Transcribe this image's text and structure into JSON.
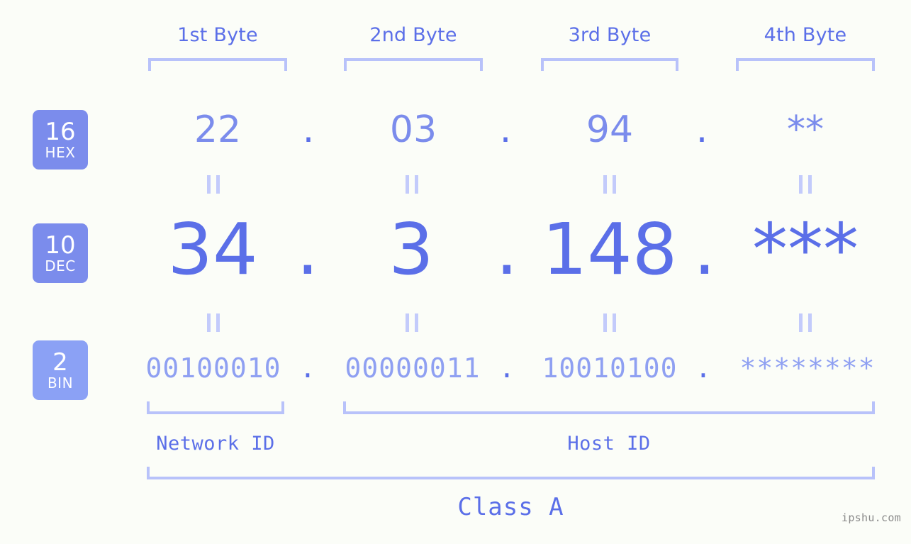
{
  "background_color": "#fbfdf8",
  "accent_color": "#5b6fe8",
  "accent_light_color": "#7b8cec",
  "bracket_color": "#b8c2fa",
  "byte_headers": [
    {
      "label": "1st Byte"
    },
    {
      "label": "2nd Byte"
    },
    {
      "label": "3rd Byte"
    },
    {
      "label": "4th Byte"
    }
  ],
  "bases": [
    {
      "number": "16",
      "name": "HEX"
    },
    {
      "number": "10",
      "name": "DEC"
    },
    {
      "number": "2",
      "name": "BIN"
    }
  ],
  "rows": {
    "hex": {
      "values": [
        "22",
        "03",
        "94",
        "**"
      ],
      "separator": "."
    },
    "dec": {
      "values": [
        "34",
        "3",
        "148",
        "***"
      ],
      "separator": "."
    },
    "bin": {
      "values": [
        "00100010",
        "00000011",
        "10010100",
        "********"
      ],
      "separator": "."
    }
  },
  "equals_symbol": "=",
  "segments": {
    "network_id": "Network ID",
    "host_id": "Host ID",
    "class": "Class A"
  },
  "watermark": "ipshu.com"
}
